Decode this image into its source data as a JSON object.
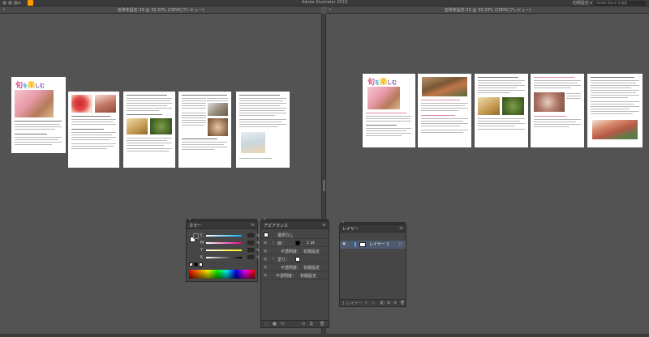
{
  "app": {
    "title": "Adobe Illustrator 2019",
    "workspace": "初期設定 ▾",
    "search_placeholder": "Adobe Stock を検索",
    "home_icon": "home-icon",
    "brand_color": "#ff9a00"
  },
  "documents": [
    {
      "tab_title": "名称未設定-29 @ 33.33% (CMYK/プレビュー)"
    },
    {
      "tab_title": "名称未設定-30 @ 33.33% (CMYK/プレビュー)"
    }
  ],
  "pages": {
    "logo_text": "旬を楽しむ"
  },
  "panels": {
    "color": {
      "tab": "カラー",
      "channels": [
        {
          "label": "C",
          "value": "",
          "unit": "%"
        },
        {
          "label": "M",
          "value": "",
          "unit": "%"
        },
        {
          "label": "Y",
          "value": "",
          "unit": "%"
        },
        {
          "label": "K",
          "value": "",
          "unit": "%"
        }
      ]
    },
    "appearance": {
      "tab": "アピアランス",
      "selection": "選択なし",
      "stroke_label": "線：",
      "stroke_value": "1 pt",
      "opacity_label": "不透明度：",
      "opacity_value": "初期設定",
      "fill_label": "塗り：",
      "rows_opacity": [
        {
          "label": "不透明度：",
          "value": "初期設定"
        },
        {
          "label": "不透明度：",
          "value": "初期設定"
        }
      ]
    },
    "layers": {
      "tab": "レイヤー",
      "layer_name": "レイヤー 1",
      "count_label": "1 レイヤー",
      "highlight_color": "#4b9eff"
    }
  }
}
